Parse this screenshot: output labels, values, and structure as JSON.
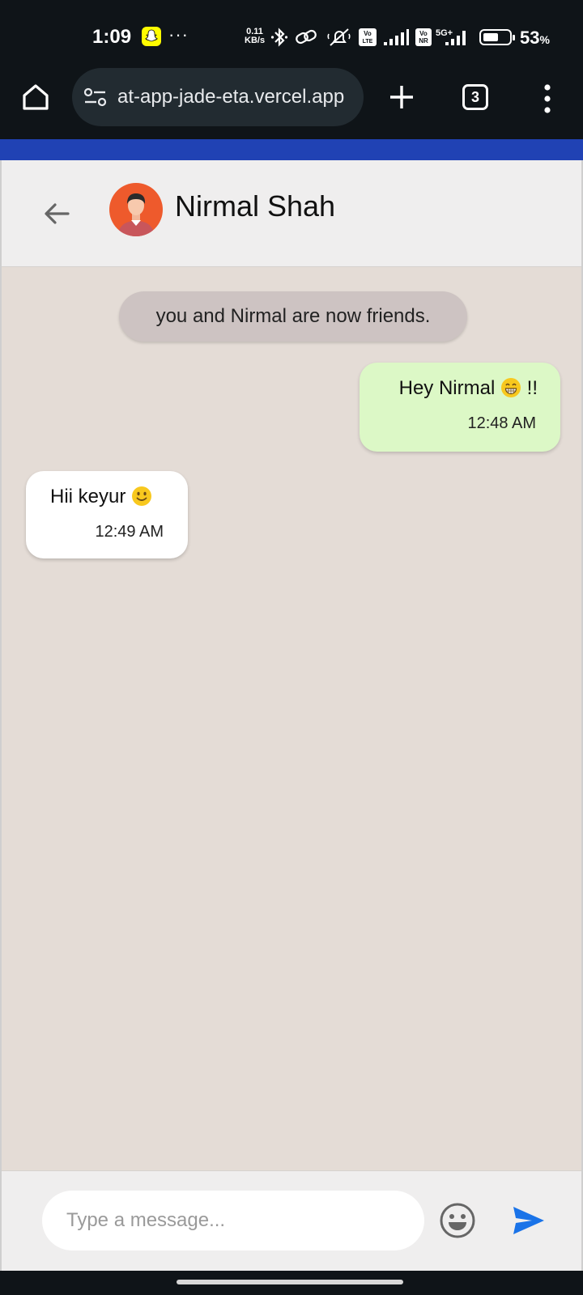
{
  "status_bar": {
    "time": "1:09",
    "network_speed_value": "0.11",
    "network_speed_unit": "KB/s",
    "battery_percent": "53",
    "battery_unit": "%",
    "icons": [
      "snapchat-icon",
      "more-dots",
      "bluetooth-icon",
      "link-icon",
      "alarm-off-icon",
      "volte-icon",
      "signal-icon",
      "vonr-icon",
      "5g-signal-icon",
      "battery-icon"
    ]
  },
  "browser": {
    "url": "at-app-jade-eta.vercel.app",
    "tab_count": "3"
  },
  "chat": {
    "contact_name": "Nirmal Shah",
    "system_message": "you and Nirmal are now friends.",
    "messages": [
      {
        "direction": "outgoing",
        "text_before": "Hey Nirmal",
        "emoji": "grinning-face",
        "text_after": "!!",
        "time": "12:48 AM"
      },
      {
        "direction": "incoming",
        "text_before": "Hii keyur",
        "emoji": "slightly-smiling-face",
        "text_after": "",
        "time": "12:49 AM"
      }
    ],
    "input_placeholder": "Type a message...",
    "input_value": ""
  },
  "colors": {
    "accent_strip": "#2042b4",
    "chat_background": "#e4dcd6",
    "outgoing_bubble": "#dcf8c6",
    "incoming_bubble": "#ffffff",
    "system_bubble": "#cdc3c2",
    "send_icon": "#1a73e8"
  }
}
